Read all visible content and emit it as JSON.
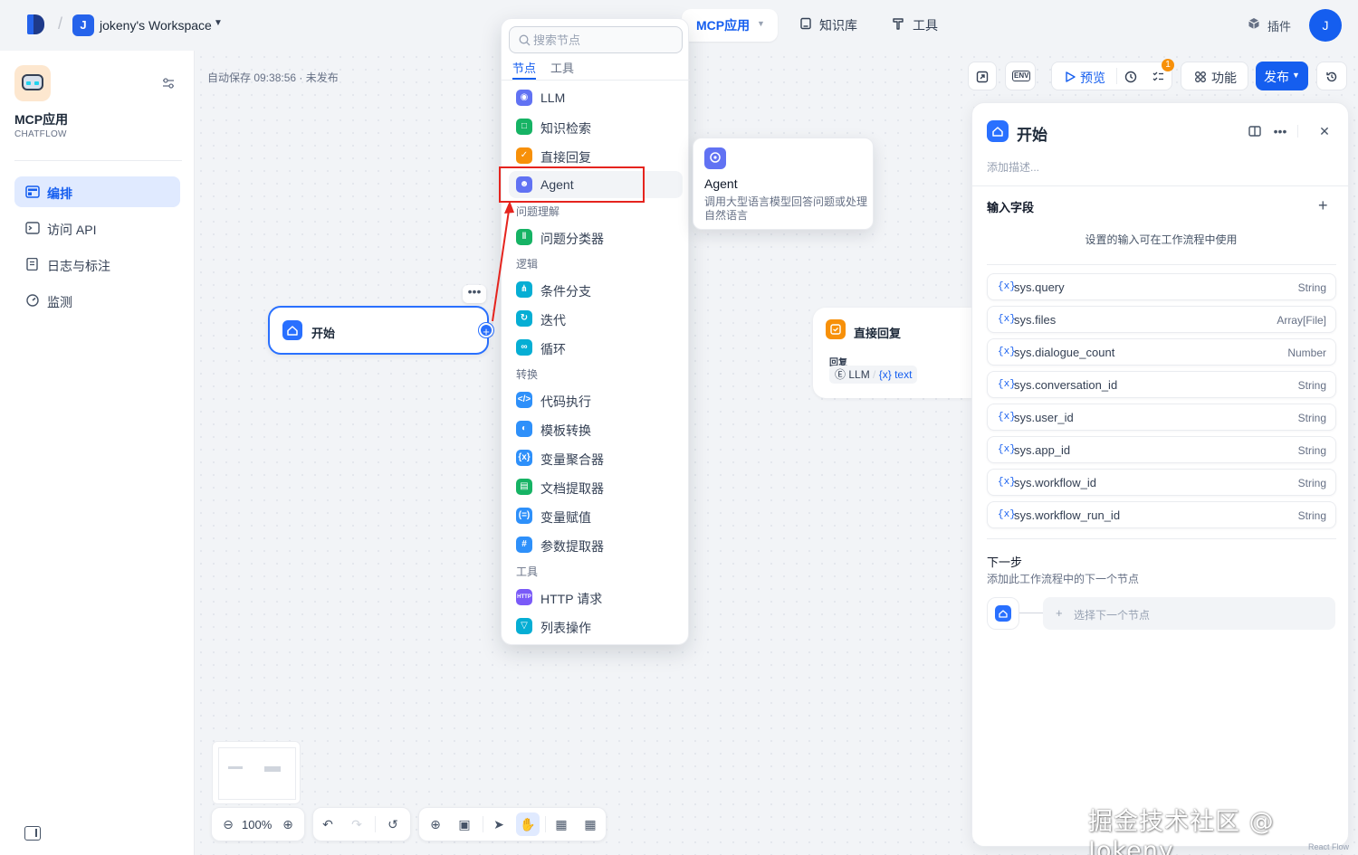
{
  "workspace": {
    "initial": "J",
    "name": "jokeny's Workspace"
  },
  "nav": {
    "app": "MCP应用",
    "knowledge": "知识库",
    "tools": "工具",
    "plugins": "插件"
  },
  "user": {
    "initial": "J"
  },
  "app": {
    "title": "MCP应用",
    "type": "CHATFLOW"
  },
  "sidebar": {
    "items": [
      {
        "label": "编排",
        "active": true
      },
      {
        "label": "访问 API"
      },
      {
        "label": "日志与标注"
      },
      {
        "label": "监测"
      }
    ]
  },
  "canvas": {
    "autosave": "自动保存 09:38:56 · 未发布",
    "zoom": "100%"
  },
  "toolbar": {
    "env": "ENV",
    "preview": "预览",
    "checklist_badge": "1",
    "features": "功能",
    "publish": "发布"
  },
  "start_node": {
    "title": "开始"
  },
  "reply_node": {
    "title": "直接回复",
    "sub": "回复",
    "chip_node": "LLM",
    "chip_var": "text"
  },
  "picker": {
    "search_placeholder": "搜索节点",
    "tabs": [
      "节点",
      "工具"
    ],
    "items": [
      {
        "label": "LLM",
        "color": "#6172f3"
      },
      {
        "label": "知识检索",
        "color": "#16b364"
      },
      {
        "label": "直接回复",
        "color": "#f79009"
      },
      {
        "label": "Agent",
        "color": "#6172f3"
      }
    ],
    "group_understanding": "问题理解",
    "classifier": "问题分类器",
    "group_logic": "逻辑",
    "logic": [
      "条件分支",
      "迭代",
      "循环"
    ],
    "group_transform": "转换",
    "transform": [
      "代码执行",
      "模板转换",
      "变量聚合器",
      "文档提取器",
      "变量赋值",
      "参数提取器"
    ],
    "group_tools": "工具",
    "tools": [
      "HTTP 请求",
      "列表操作"
    ]
  },
  "agent_tip": {
    "title": "Agent",
    "desc": "调用大型语言模型回答问题或处理自然语言"
  },
  "panel": {
    "title": "开始",
    "desc_placeholder": "添加描述...",
    "inputs_title": "输入字段",
    "inputs_hint": "设置的输入可在工作流程中使用",
    "vars": [
      {
        "name": "sys.query",
        "type": "String"
      },
      {
        "name": "sys.files",
        "type": "Array[File]"
      },
      {
        "name": "sys.dialogue_count",
        "type": "Number"
      },
      {
        "name": "sys.conversation_id",
        "type": "String"
      },
      {
        "name": "sys.user_id",
        "type": "String"
      },
      {
        "name": "sys.app_id",
        "type": "String"
      },
      {
        "name": "sys.workflow_id",
        "type": "String"
      },
      {
        "name": "sys.workflow_run_id",
        "type": "String"
      }
    ],
    "next_title": "下一步",
    "next_desc": "添加此工作流程中的下一个节点",
    "next_select": "选择下一个节点"
  },
  "watermark": "掘金技术社区 @ Jokeny",
  "reactflow_label": "React Flow"
}
